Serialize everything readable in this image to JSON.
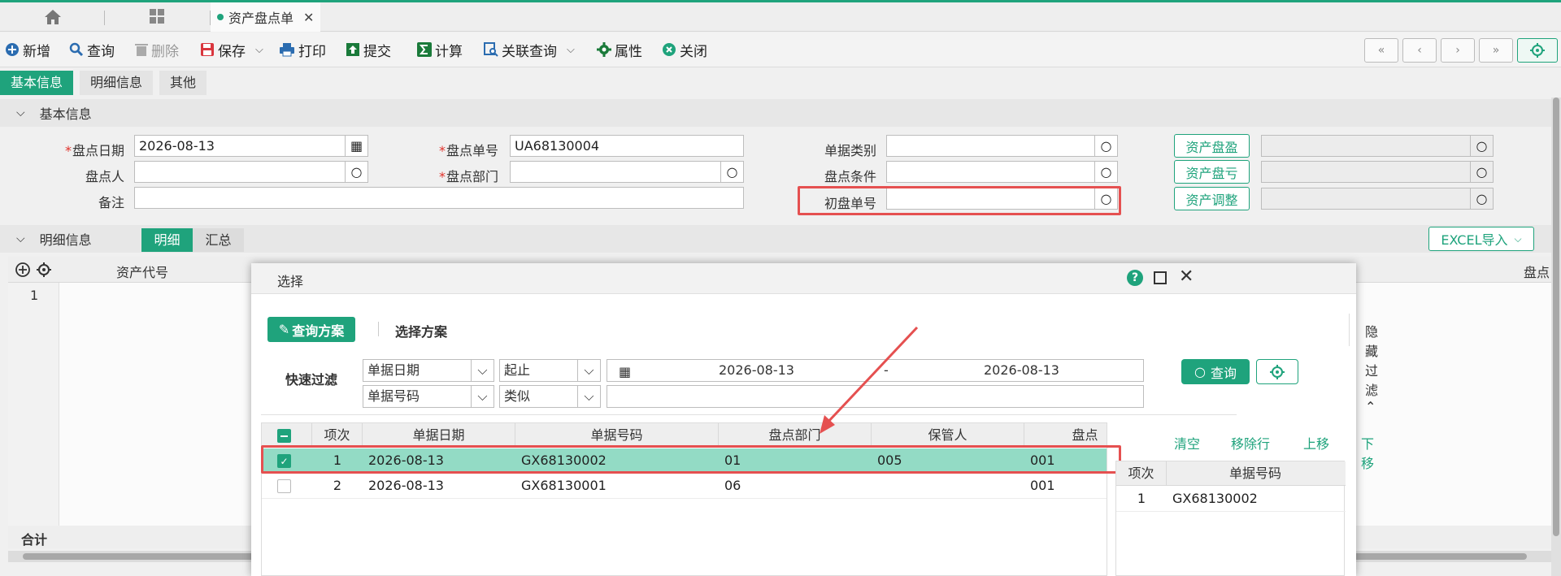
{
  "tabbar": {
    "active_tab": "资产盘点单"
  },
  "toolbar": {
    "add": "新增",
    "query": "查询",
    "delete": "删除",
    "save": "保存",
    "print": "打印",
    "submit": "提交",
    "calc": "计算",
    "related": "关联查询",
    "props": "属性",
    "close": "关闭"
  },
  "subtabs": [
    "基本信息",
    "明细信息",
    "其他"
  ],
  "basic": {
    "section_title": "基本信息",
    "check_date_label": "盘点日期",
    "check_date": "2026-08-13",
    "check_no_label": "盘点单号",
    "check_no": "UA68130004",
    "doc_type_label": "单据类别",
    "checker_label": "盘点人",
    "dept_label": "盘点部门",
    "cond_label": "盘点条件",
    "remark_label": "备注",
    "init_no_label": "初盘单号",
    "btn_surplus": "资产盘盈",
    "btn_loss": "资产盘亏",
    "btn_adjust": "资产调整"
  },
  "detail": {
    "section_title": "明细信息",
    "tab_detail": "明细",
    "tab_summary": "汇总",
    "excel": "EXCEL导入",
    "col_asset_code": "资产代号",
    "col_right": "盘点",
    "row1": "1",
    "total": "合计"
  },
  "modal": {
    "title": "选择",
    "help": "?",
    "plan_btn": "查询方案",
    "choose_plan": "选择方案",
    "hide_filter": "隐藏过滤",
    "quick_filter": "快速过滤",
    "f1_field": "单据日期",
    "f1_op": "起止",
    "f1_from": "2026-08-13",
    "f1_dash": "-",
    "f1_to": "2026-08-13",
    "f2_field": "单据号码",
    "f2_op": "类似",
    "f2_value": "",
    "query_btn": "查询",
    "columns": [
      "项次",
      "单据日期",
      "单据号码",
      "盘点部门",
      "保管人",
      "盘点"
    ],
    "rows": [
      {
        "no": "1",
        "date": "2026-08-13",
        "code": "GX68130002",
        "dept": "01",
        "keeper": "005",
        "check": "001",
        "checked": true
      },
      {
        "no": "2",
        "date": "2026-08-13",
        "code": "GX68130001",
        "dept": "06",
        "keeper": "",
        "check": "001",
        "checked": false
      }
    ],
    "actions": {
      "clear": "清空",
      "remove": "移除行",
      "up": "上移",
      "down": "下移"
    },
    "right_cols": [
      "项次",
      "单据号码"
    ],
    "right_rows": [
      {
        "no": "1",
        "code": "GX68130002"
      }
    ]
  },
  "colors": {
    "accent": "#1fa37c",
    "highlight_row": "#93dbc5",
    "annotation": "#e55050"
  }
}
